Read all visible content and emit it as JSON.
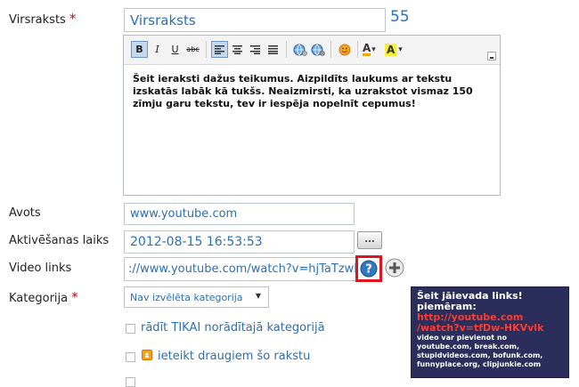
{
  "form": {
    "title": {
      "label": "Virsraksts",
      "required_mark": "*",
      "value": "Virsraksts",
      "char_count": "55"
    },
    "editor": {
      "toolbar": {
        "bold": "B",
        "italic": "I",
        "underline": "U",
        "strike": "abc",
        "text_color": "A",
        "bg_color": "A",
        "dropdown_arrow": "▾"
      },
      "body": "Šeit ieraksti dažus teikumus. Aizpildīts laukums ar tekstu izskatās labāk kā tukšs. Neaizmirsti, ka uzrakstot vismaz 150 zīmju garu tekstu, tev ir iespēja nopelnīt cepumus!"
    },
    "source": {
      "label": "Avots",
      "value": "www.youtube.com"
    },
    "activation": {
      "label": "Aktivēšanas laiks",
      "value": "2012-08-15 16:53:53",
      "picker_label": "..."
    },
    "video": {
      "label": "Video links",
      "value": "://www.youtube.com/watch?v=hjTaTzwPvPE"
    },
    "category": {
      "label": "Kategorija",
      "required_mark": "*",
      "selected": "Nav izvēlēta kategorija",
      "arrow": "▼"
    },
    "only_category": {
      "label": "rādīt TIKAI norādītajā kategorijā"
    },
    "recommend": {
      "label": "ieteikt draugiem šo rakstu"
    }
  },
  "tooltip": {
    "line1": "Šeit jāievada links!",
    "line2": "piemēram:",
    "link1": "http://youtube.com",
    "link2": "/watch?v=tfDw-HKVvlk",
    "line3": "video var pievienot no",
    "line4": "youtube.com, break.com,",
    "line5": "stupidvideos.com, bofunk.com,",
    "line6": "funnyplace.org, clipjunkie.com"
  },
  "colors": {
    "accent": "#2c6fb5",
    "required": "#d40000",
    "tooltip_bg": "#2b2e5a",
    "tooltip_link": "#ff3b30",
    "help_border": "#e0141e"
  }
}
